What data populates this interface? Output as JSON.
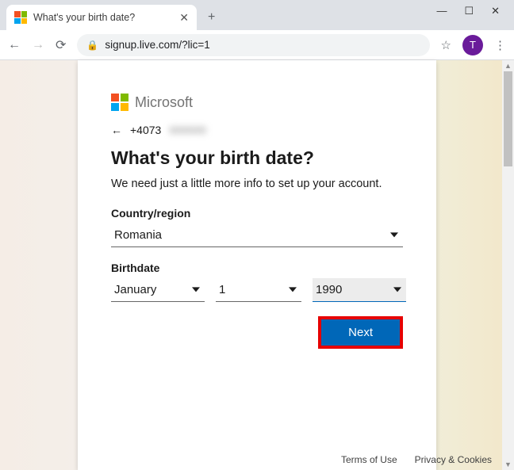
{
  "browser": {
    "tab_title": "What's your birth date?",
    "url": "signup.live.com/?lic=1",
    "avatar_initial": "T"
  },
  "card": {
    "brand": "Microsoft",
    "phone_prefix": "+4073",
    "heading": "What's your birth date?",
    "subtext": "We need just a little more info to set up your account.",
    "country_label": "Country/region",
    "country_value": "Romania",
    "birthdate_label": "Birthdate",
    "month_value": "January",
    "day_value": "1",
    "year_value": "1990",
    "next_label": "Next"
  },
  "footer": {
    "terms": "Terms of Use",
    "privacy": "Privacy & Cookies"
  }
}
